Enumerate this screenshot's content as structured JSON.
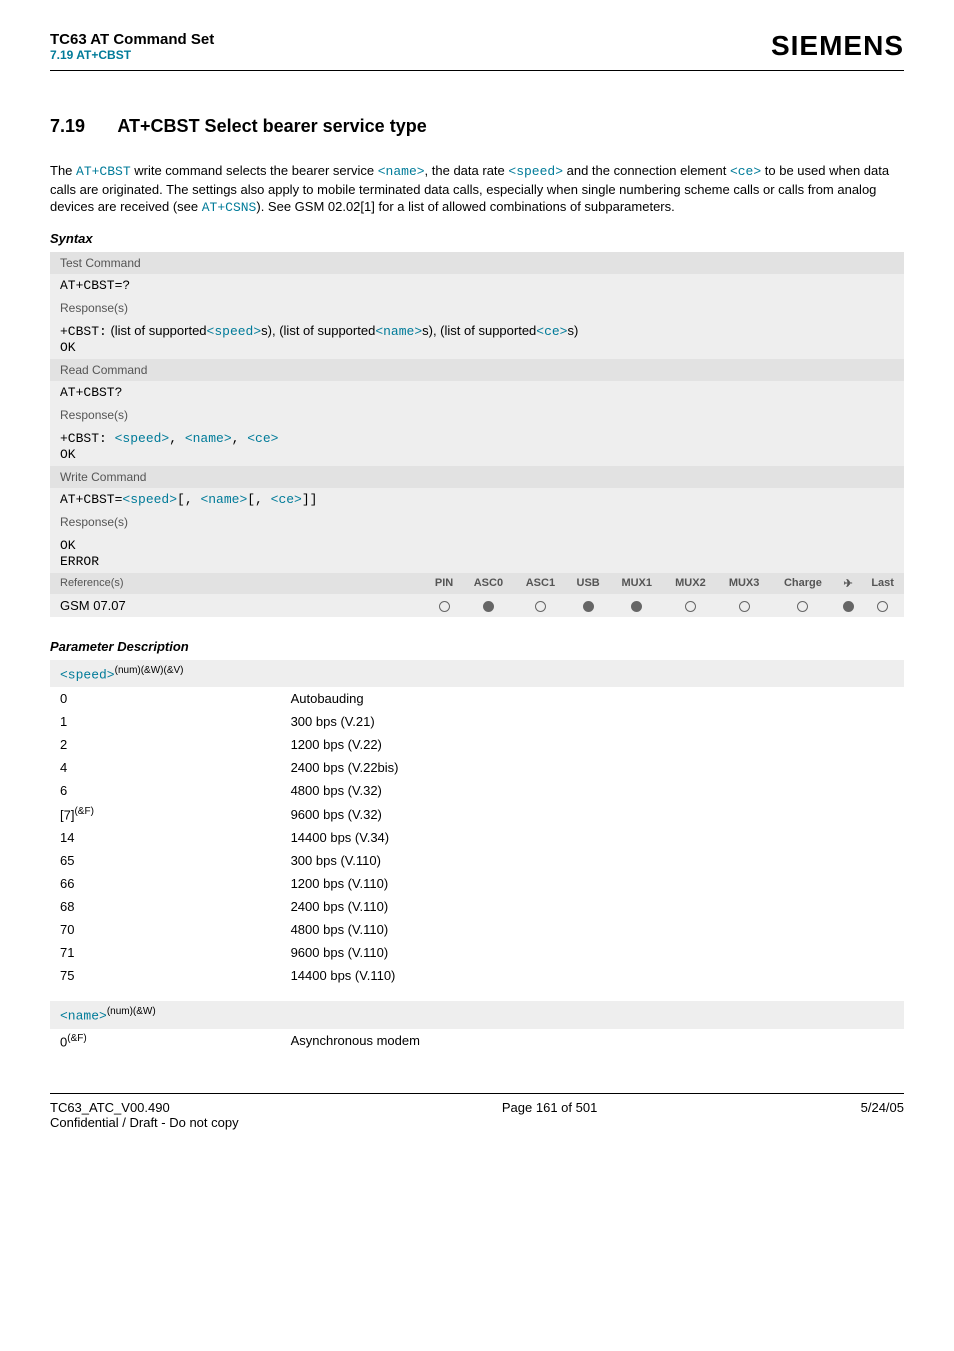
{
  "header": {
    "doc_title": "TC63 AT Command Set",
    "sub_title": "7.19 AT+CBST",
    "brand": "SIEMENS"
  },
  "section": {
    "number": "7.19",
    "title": "AT+CBST   Select bearer service type"
  },
  "intro": {
    "p1a": "The ",
    "at_cbst": "AT+CBST",
    "p1b": " write command selects the bearer service ",
    "name_tok": "<name>",
    "p1c": ", the data rate ",
    "speed_tok": "<speed>",
    "p1d": " and the connection element ",
    "ce_tok": "<ce>",
    "p1e": " to be used when data calls are originated. The settings also apply to mobile terminated data calls, especially when single numbering scheme calls or calls from analog devices are received (see ",
    "at_csns": "AT+CSNS",
    "p1f": "). See GSM 02.02[1] for a list of allowed combinations of subparameters."
  },
  "syntax_label": "Syntax",
  "test_cmd": {
    "header": "Test Command",
    "cmd": "AT+CBST=?",
    "resp_label": "Response(s)",
    "resp_prefix": "+CBST:",
    "resp_t1": "(list of supported",
    "resp_tok1": "<speed>",
    "resp_t2": "s), (list of supported",
    "resp_tok2": "<name>",
    "resp_t3": "s), (list of supported",
    "resp_tok3": "<ce>",
    "resp_t4": "s)",
    "ok": "OK"
  },
  "read_cmd": {
    "header": "Read Command",
    "cmd": "AT+CBST?",
    "resp_label": "Response(s)",
    "resp_prefix": "+CBST: ",
    "tok1": "<speed>",
    "sep1": ", ",
    "tok2": "<name>",
    "sep2": ", ",
    "tok3": "<ce>",
    "ok": "OK"
  },
  "write_cmd": {
    "header": "Write Command",
    "prefix": "AT+CBST=",
    "tok1": "<speed>",
    "b1": "[, ",
    "tok2": "<name>",
    "b2": "[, ",
    "tok3": "<ce>",
    "b3": "]]",
    "resp_label": "Response(s)",
    "ok": "OK",
    "error": "ERROR"
  },
  "ref": {
    "label": "Reference(s)",
    "cols": [
      "PIN",
      "ASC0",
      "ASC1",
      "USB",
      "MUX1",
      "MUX2",
      "MUX3",
      "Charge",
      "✈",
      "Last"
    ],
    "value": "GSM 07.07",
    "dots": [
      "open",
      "filled",
      "open",
      "filled",
      "filled",
      "open",
      "open",
      "open",
      "filled",
      "open"
    ]
  },
  "param_desc_label": "Parameter Description",
  "speed_param": {
    "name": "<speed>",
    "attrs": "(num)(&W)(&V)",
    "rows": [
      {
        "v": "0",
        "d": "Autobauding"
      },
      {
        "v": "1",
        "d": "300 bps (V.21)"
      },
      {
        "v": "2",
        "d": "1200 bps (V.22)"
      },
      {
        "v": "4",
        "d": "2400 bps (V.22bis)"
      },
      {
        "v": "6",
        "d": "4800 bps (V.32)"
      },
      {
        "v": "[7]",
        "sup": "(&F)",
        "d": "9600 bps (V.32)"
      },
      {
        "v": "14",
        "d": "14400 bps (V.34)"
      },
      {
        "v": "65",
        "d": "300 bps (V.110)"
      },
      {
        "v": "66",
        "d": "1200 bps (V.110)"
      },
      {
        "v": "68",
        "d": "2400 bps (V.110)"
      },
      {
        "v": "70",
        "d": "4800 bps (V.110)"
      },
      {
        "v": "71",
        "d": "9600 bps (V.110)"
      },
      {
        "v": "75",
        "d": "14400 bps (V.110)"
      }
    ]
  },
  "name_param": {
    "name": "<name>",
    "attrs": "(num)(&W)",
    "rows": [
      {
        "v": "0",
        "sup": "(&F)",
        "d": "Asynchronous modem"
      }
    ]
  },
  "footer": {
    "left1": "TC63_ATC_V00.490",
    "left2": "Confidential / Draft - Do not copy",
    "mid": "Page 161 of 501",
    "right": "5/24/05"
  }
}
